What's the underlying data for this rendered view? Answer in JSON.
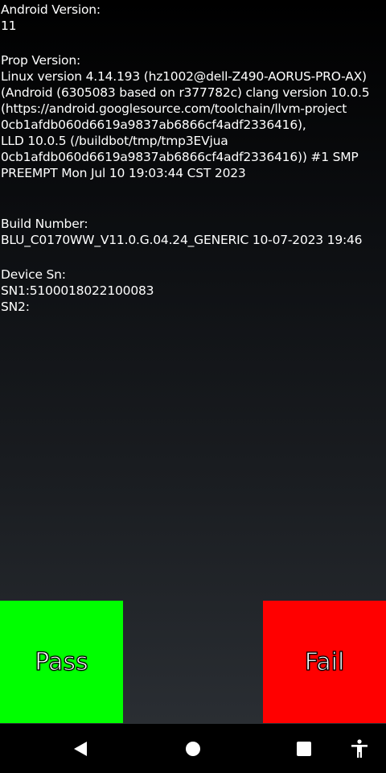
{
  "info": {
    "android_version_label": "Android Version:",
    "android_version_value": "11",
    "prop_version_label": "Prop Version:",
    "prop_version_lines": [
      "Linux version 4.14.193 (hz1002@dell-Z490-AORUS-PRO-AX)",
      "(Android (6305083 based on r377782c) clang version 10.0.5",
      "(https://android.googlesource.com/toolchain/llvm-project",
      "0cb1afdb060d6619a9837ab6866cf4adf2336416),",
      "LLD 10.0.5 (/buildbot/tmp/tmp3EVjua",
      "0cb1afdb060d6619a9837ab6866cf4adf2336416)) #1 SMP",
      "PREEMPT Mon Jul 10 19:03:44 CST 2023"
    ],
    "build_number_label": "Build Number:",
    "build_number_value": "BLU_C0170WW_V11.0.G.04.24_GENERIC 10-07-2023 19:46",
    "device_sn_label": "Device Sn:",
    "sn1": "SN1:5100018022100083",
    "sn2": "SN2:"
  },
  "buttons": {
    "pass_label": "Pass",
    "fail_label": "Fail"
  },
  "colors": {
    "pass": "#00ff00",
    "fail": "#ff0000",
    "text": "#ffffff",
    "navbar": "#000000"
  },
  "navbar": {
    "icons": [
      "back-icon",
      "home-icon",
      "recents-icon",
      "accessibility-icon"
    ]
  }
}
